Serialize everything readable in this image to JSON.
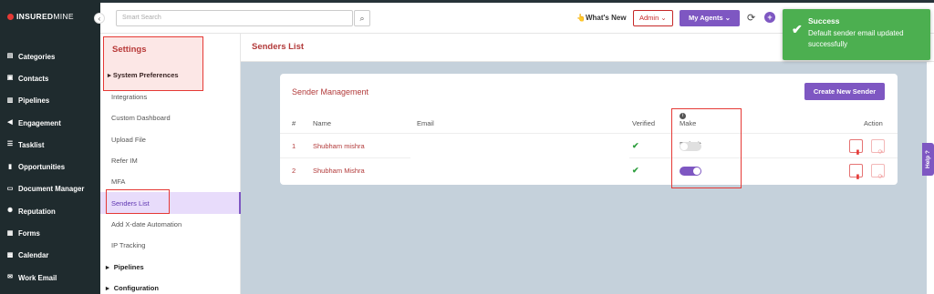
{
  "brand": {
    "name_part1": "INSURED",
    "name_part2": "MINE"
  },
  "sidebar": {
    "items": [
      {
        "label": "Categories",
        "icon": "layers-icon",
        "glyph": "▤"
      },
      {
        "label": "Contacts",
        "icon": "contacts-icon",
        "glyph": "▣"
      },
      {
        "label": "Pipelines",
        "icon": "pipeline-icon",
        "glyph": "▥"
      },
      {
        "label": "Engagement",
        "icon": "megaphone-icon",
        "glyph": "◀"
      },
      {
        "label": "Tasklist",
        "icon": "tasklist-icon",
        "glyph": "☰"
      },
      {
        "label": "Opportunities",
        "icon": "bar-chart-icon",
        "glyph": "▮"
      },
      {
        "label": "Document Manager",
        "icon": "folder-icon",
        "glyph": "▭"
      },
      {
        "label": "Reputation",
        "icon": "gear-icon",
        "glyph": "✺"
      },
      {
        "label": "Forms",
        "icon": "forms-icon",
        "glyph": "▦"
      },
      {
        "label": "Calendar",
        "icon": "calendar-icon",
        "glyph": "▩"
      },
      {
        "label": "Work Email",
        "icon": "mail-icon",
        "glyph": "✉"
      }
    ]
  },
  "topbar": {
    "search_placeholder": "Smart Search",
    "whats_new": "👆What's New",
    "admin": "Admin ⌄",
    "my_agents": "My Agents ⌄"
  },
  "settings": {
    "title": "Settings",
    "section": "System Preferences",
    "items": [
      "Integrations",
      "Custom Dashboard",
      "Upload File",
      "Refer IM",
      "MFA",
      "Senders List",
      "Add X-date Automation",
      "IP Tracking"
    ],
    "groups": [
      "Pipelines",
      "Configuration"
    ]
  },
  "main": {
    "title": "Senders List",
    "card_title": "Sender Management",
    "create_button": "Create New Sender",
    "columns": [
      "#",
      "Name",
      "Email",
      "Verified",
      "Make Default",
      "Action"
    ],
    "rows": [
      {
        "num": "1",
        "name": "Shubham mishra",
        "verified": "✔",
        "default": false
      },
      {
        "num": "2",
        "name": "Shubham Mishra",
        "verified": "✔",
        "default": true
      }
    ]
  },
  "help": "Help",
  "toast": {
    "title": "Success",
    "message": "Default sender email updated successfully",
    "color": "#4caf50"
  }
}
